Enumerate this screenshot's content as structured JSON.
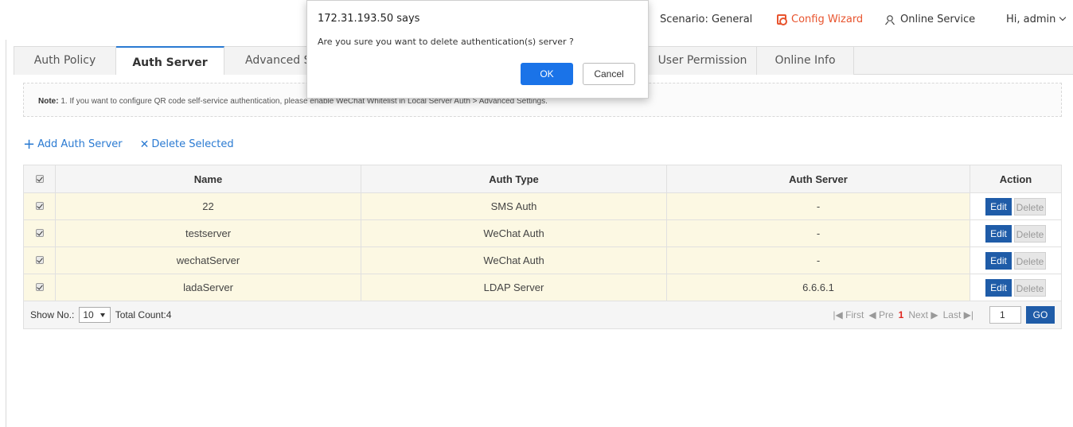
{
  "header": {
    "scenario_label": "Scenario:",
    "scenario_value": "General",
    "config_wizard": "Config Wizard",
    "online_service": "Online Service",
    "greeting": "Hi, admin"
  },
  "tabs": [
    {
      "label": "Auth Policy",
      "active": false
    },
    {
      "label": "Auth Server",
      "active": true
    },
    {
      "label": "Advanced S",
      "active": false
    },
    {
      "label": "User Permission",
      "active": false
    },
    {
      "label": "Online Info",
      "active": false
    }
  ],
  "note": {
    "label": "Note:",
    "text": "1. If you want to configure QR code self-service authentication, please enable WeChat Whitelist in Local Server Auth > Advanced Settings."
  },
  "actions": {
    "add": "Add Auth Server",
    "delete_selected": "Delete Selected"
  },
  "table": {
    "columns": [
      "Name",
      "Auth Type",
      "Auth Server",
      "Action"
    ],
    "rows": [
      {
        "name": "22",
        "auth_type": "SMS Auth",
        "auth_server": "-",
        "checked": true
      },
      {
        "name": "testserver",
        "auth_type": "WeChat Auth",
        "auth_server": "-",
        "checked": true
      },
      {
        "name": "wechatServer",
        "auth_type": "WeChat Auth",
        "auth_server": "-",
        "checked": true
      },
      {
        "name": "ladaServer",
        "auth_type": "LDAP Server",
        "auth_server": "6.6.6.1",
        "checked": true
      }
    ],
    "edit_label": "Edit",
    "delete_label": "Delete"
  },
  "pager": {
    "show_no_label": "Show No.:",
    "page_size": "10",
    "total_count": "Total Count:4",
    "first": "First",
    "prev": "Pre",
    "current_page": "1",
    "next": "Next",
    "last": "Last",
    "page_input": "1",
    "go": "GO"
  },
  "dialog": {
    "title": "172.31.193.50 says",
    "message": "Are you sure you want to  delete authentication(s) server ?",
    "ok": "OK",
    "cancel": "Cancel"
  },
  "colors": {
    "accent": "#2a7ad2",
    "wizard": "#e8542e",
    "row_highlight": "#fcf8e3",
    "button_primary": "#1f5ca8",
    "dialog_ok": "#1a73e8"
  }
}
